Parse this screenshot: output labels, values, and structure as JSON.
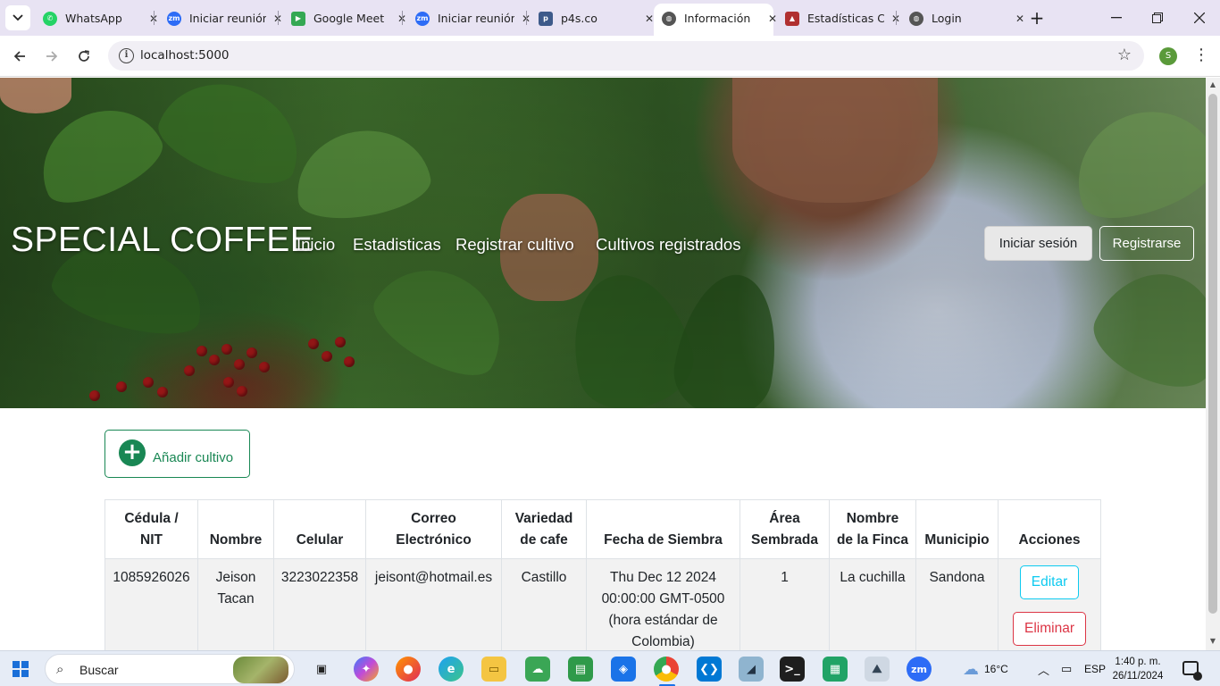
{
  "browser": {
    "tabs": [
      {
        "title": "WhatsApp",
        "icon": "whatsapp-icon",
        "color": "#25d366"
      },
      {
        "title": "Iniciar reunión",
        "icon": "zoom-icon",
        "color": "#2d6cf6"
      },
      {
        "title": "Google Meet",
        "icon": "google-meet-icon",
        "color": "#34a853"
      },
      {
        "title": "Iniciar reunión",
        "icon": "zoom-icon",
        "color": "#2d6cf6"
      },
      {
        "title": "p4s.co",
        "icon": "p4s-icon",
        "color": "#3d5a8a"
      },
      {
        "title": "Información",
        "icon": "globe-icon",
        "color": "#555555",
        "active": true
      },
      {
        "title": "Estadísticas C",
        "icon": "stats-icon",
        "color": "#b03030"
      },
      {
        "title": "Login",
        "icon": "globe-icon",
        "color": "#555555"
      }
    ],
    "new_tab": "+",
    "url": "localhost:5000",
    "profile_initial": "S"
  },
  "site": {
    "brand": "SPECIAL COFFEE",
    "nav": [
      "Inicio",
      "Estadisticas",
      "Registrar cultivo",
      "Cultivos registrados"
    ],
    "login_label": "Iniciar sesión",
    "register_label": "Registrarse"
  },
  "add_button": {
    "label": "Añadir cultivo"
  },
  "table": {
    "headers": [
      [
        "Cédula /",
        "NIT"
      ],
      [
        "Nombre"
      ],
      [
        "Celular"
      ],
      [
        "Correo",
        "Electrónico"
      ],
      [
        "Variedad",
        "de cafe"
      ],
      [
        "Fecha de Siembra"
      ],
      [
        "Área",
        "Sembrada"
      ],
      [
        "Nombre",
        "de la Finca"
      ],
      [
        "Municipio"
      ],
      [
        "Acciones"
      ]
    ],
    "rows": [
      {
        "cedula": "1085926026",
        "nombre_1": "Jeison",
        "nombre_2": "Tacan",
        "celular": "3223022358",
        "correo": "jeisont@hotmail.es",
        "variedad": "Castillo",
        "fecha_1": "Thu Dec 12 2024",
        "fecha_2": "00:00:00 GMT-0500",
        "fecha_3": "(hora estándar de",
        "fecha_4": "Colombia)",
        "area": "1",
        "finca": "La cuchilla",
        "municipio": "Sandona",
        "edit_label": "Editar",
        "delete_label": "Eliminar"
      }
    ]
  },
  "taskbar": {
    "search_placeholder": "Buscar",
    "weather": "16°C",
    "language": "ESP",
    "time": "1:40 p. m.",
    "date": "26/11/2024"
  },
  "colors": {
    "success": "#198754",
    "info": "#0dcaf0",
    "danger": "#dc3545",
    "tab_strip": "#e8e3f3"
  }
}
